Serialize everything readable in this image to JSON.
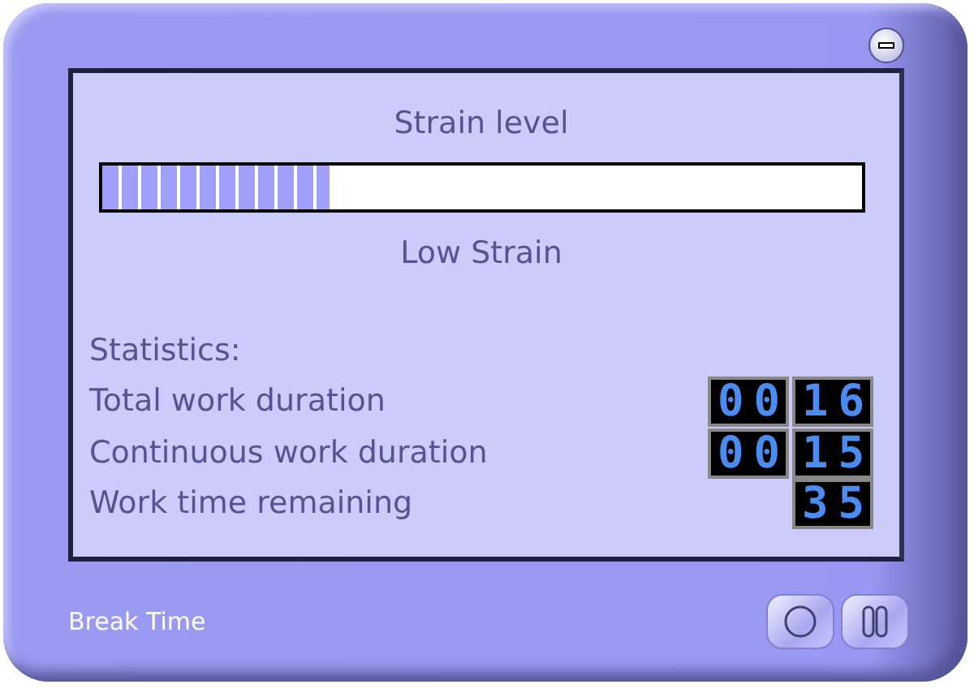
{
  "title": "Strain level",
  "strain": {
    "level": 0.3,
    "label": "Low Strain"
  },
  "statistics": {
    "heading": "Statistics:",
    "rows": [
      {
        "label": "Total work duration",
        "values": [
          "00",
          "16"
        ]
      },
      {
        "label": "Continuous work duration",
        "values": [
          "00",
          "15"
        ]
      },
      {
        "label": "Work time remaining",
        "values": [
          "35"
        ]
      }
    ]
  },
  "footer": {
    "label": "Break Time"
  }
}
